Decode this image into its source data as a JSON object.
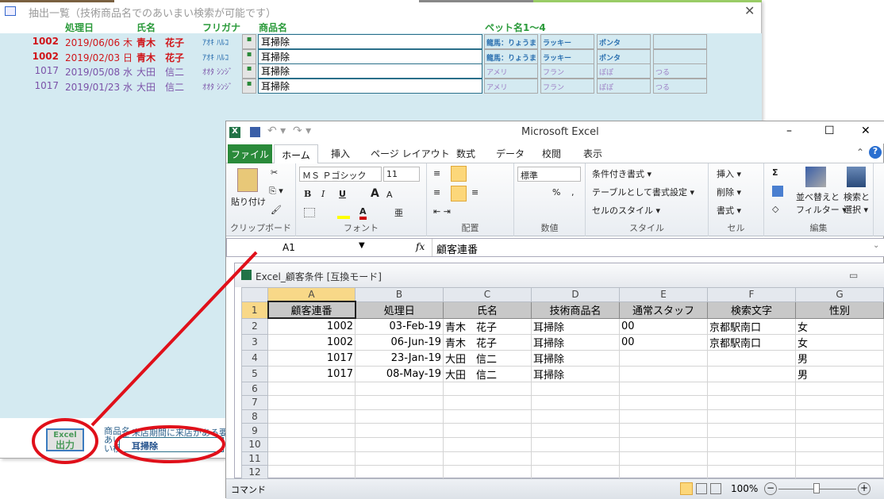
{
  "access": {
    "title": "抽出一覧（技術商品名でのあいまい検索が可能です）",
    "headers": {
      "date": "処理日",
      "name": "氏名",
      "kana": "フリガナ",
      "product": "商品名",
      "pets": "ペット名1～4"
    },
    "rows": [
      {
        "id": "1002",
        "date": "2019/06/06 木",
        "name": "青木　花子",
        "kana": "ｱｵｷ ﾊﾙｺ",
        "product": "耳掃除",
        "pets": [
          "龍馬：りょうま",
          "ラッキー",
          "ポンタ",
          ""
        ],
        "style": "hot"
      },
      {
        "id": "1002",
        "date": "2019/02/03 日",
        "name": "青木　花子",
        "kana": "ｱｵｷ ﾊﾙｺ",
        "product": "耳掃除",
        "pets": [
          "龍馬：りょうま",
          "ラッキー",
          "ポンタ",
          ""
        ],
        "style": "hot"
      },
      {
        "id": "1017",
        "date": "2019/05/08 水",
        "name": "大田　信二",
        "kana": "ｵｵﾀ ｼﾝｼﾞ",
        "product": "耳掃除",
        "pets": [
          "アメリ",
          "フラン",
          "ぽぽ",
          "つる"
        ],
        "style": "cool"
      },
      {
        "id": "1017",
        "date": "2019/01/23 水",
        "name": "大田　信二",
        "kana": "ｵｵﾀ ｼﾝｼﾞ",
        "product": "耳掃除",
        "pets": [
          "アメリ",
          "フラン",
          "ぽぽ",
          "つる"
        ],
        "style": "cool"
      }
    ],
    "row_button": "▪",
    "excel_button": {
      "line1": "Excel",
      "line2": "出力"
    },
    "search_label": "商品名あいまい検索",
    "search_note": "来店期間に来店がある要",
    "search_value": "耳掃除",
    "close": "✕"
  },
  "excel": {
    "title": "Microsoft Excel",
    "window_controls": [
      "–",
      "☐",
      "✕"
    ],
    "tabs": [
      "ファイル",
      "ホーム",
      "挿入",
      "ページ レイアウト",
      "数式",
      "データ",
      "校閲",
      "表示"
    ],
    "ribbon": {
      "clipboard": {
        "label": "クリップボード",
        "paste": "貼り付け"
      },
      "font": {
        "label": "フォント",
        "name": "ＭＳ Ｐゴシック",
        "size": "11",
        "bold": "B",
        "italic": "I",
        "underline": "U",
        "grow": "A",
        "shrink": "A"
      },
      "alignment": {
        "label": "配置"
      },
      "number": {
        "label": "数値",
        "format": "標準",
        "percent": "%",
        "comma": ","
      },
      "styles": {
        "label": "スタイル",
        "items": [
          "条件付き書式 ▾",
          "テーブルとして書式設定 ▾",
          "セルのスタイル ▾"
        ]
      },
      "cells": {
        "label": "セル",
        "items": [
          "挿入 ▾",
          "削除 ▾",
          "書式 ▾"
        ]
      },
      "editing": {
        "label": "編集",
        "sort": "並べ替えと",
        "sort2": "フィルター ▾",
        "find": "検索と",
        "find2": "選択 ▾",
        "sum": "Σ"
      }
    },
    "namebox": "A1",
    "fx": "fx",
    "formula": "顧客連番",
    "workbook_title": "Excel_顧客条件  [互換モード]",
    "columns": [
      "A",
      "B",
      "C",
      "D",
      "E",
      "F",
      "G"
    ],
    "sheet": [
      [
        "顧客連番",
        "処理日",
        "氏名",
        "技術商品名",
        "通常スタッフ",
        "検索文字",
        "性別"
      ],
      [
        "1002",
        "03-Feb-19",
        "青木　花子",
        "耳掃除",
        "00",
        "京都駅南口",
        "女"
      ],
      [
        "1002",
        "06-Jun-19",
        "青木　花子",
        "耳掃除",
        "00",
        "京都駅南口",
        "女"
      ],
      [
        "1017",
        "23-Jan-19",
        "大田　信二",
        "耳掃除",
        "",
        "",
        "男"
      ],
      [
        "1017",
        "08-May-19",
        "大田　信二",
        "耳掃除",
        "",
        "",
        "男"
      ],
      [
        "",
        "",
        "",
        "",
        "",
        "",
        ""
      ],
      [
        "",
        "",
        "",
        "",
        "",
        "",
        ""
      ],
      [
        "",
        "",
        "",
        "",
        "",
        "",
        ""
      ],
      [
        "",
        "",
        "",
        "",
        "",
        "",
        ""
      ],
      [
        "",
        "",
        "",
        "",
        "",
        "",
        ""
      ],
      [
        "",
        "",
        "",
        "",
        "",
        "",
        ""
      ],
      [
        "",
        "",
        "",
        "",
        "",
        "",
        ""
      ],
      [
        "",
        "",
        "",
        "",
        "",
        "",
        ""
      ]
    ],
    "status": {
      "mode": "コマンド",
      "zoom": "100%"
    }
  },
  "colors": {
    "accent_green": "#2a9a3a",
    "hot_red": "#d0161b",
    "cool_purple": "#7b52a8",
    "list_bg": "#d4eaf1",
    "annotation": "#e0101a",
    "excel_file_tab": "#217346"
  }
}
